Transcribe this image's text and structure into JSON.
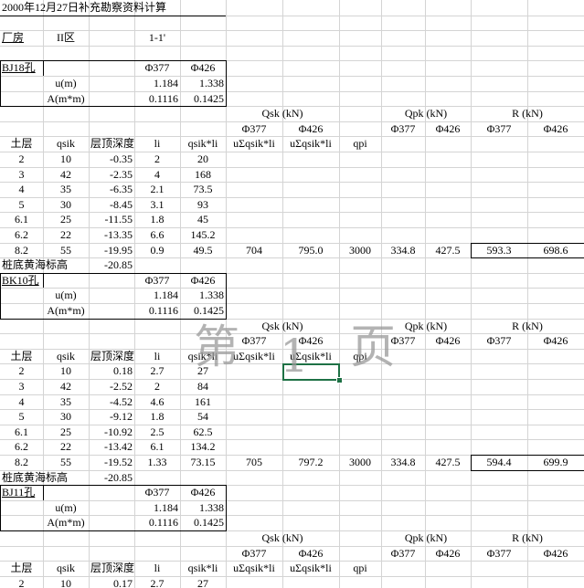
{
  "title": "2000年12月27日补充勘察资料计算",
  "header": {
    "factory": "厂房",
    "zone": "II区",
    "section": "1-1'"
  },
  "groups": [
    {
      "hole": "BJ18孔",
      "diam": [
        "Φ377",
        "Φ426"
      ],
      "u_label": "u(m)",
      "u": [
        "1.184",
        "1.338"
      ],
      "a_label": "A(m*m)",
      "a": [
        "0.1116",
        "0.1425"
      ],
      "qsk_label": "Qsk (kN)",
      "qpk_label": "Qpk (kN)",
      "r_label": "R (kN)",
      "sub_diam": [
        "Φ377",
        "Φ426",
        "Φ377",
        "Φ426",
        "Φ377",
        "Φ426"
      ],
      "headers": [
        "土层",
        "qsik",
        "层顶深度",
        "li",
        "qsik*li",
        "uΣqsik*li",
        "uΣqsik*li",
        "qpi"
      ],
      "rows": [
        [
          "2",
          "10",
          "-0.35",
          "2",
          "20"
        ],
        [
          "3",
          "42",
          "-2.35",
          "4",
          "168"
        ],
        [
          "4",
          "35",
          "-6.35",
          "2.1",
          "73.5"
        ],
        [
          "5",
          "30",
          "-8.45",
          "3.1",
          "93"
        ],
        [
          "6.1",
          "25",
          "-11.55",
          "1.8",
          "45"
        ],
        [
          "6.2",
          "22",
          "-13.35",
          "6.6",
          "145.2"
        ],
        [
          "8.2",
          "55",
          "-19.95",
          "0.9",
          "49.5",
          "704",
          "795.0",
          "3000",
          "334.8",
          "427.5",
          "593.3",
          "698.6"
        ]
      ],
      "bottom_label": "桩底黄海标高",
      "bottom_value": "-20.85"
    },
    {
      "hole": "BK10孔",
      "diam": [
        "Φ377",
        "Φ426"
      ],
      "u_label": "u(m)",
      "u": [
        "1.184",
        "1.338"
      ],
      "a_label": "A(m*m)",
      "a": [
        "0.1116",
        "0.1425"
      ],
      "qsk_label": "Qsk (kN)",
      "qpk_label": "Qpk (kN)",
      "r_label": "R (kN)",
      "sub_diam": [
        "Φ377",
        "Φ426",
        "Φ377",
        "Φ426",
        "Φ377",
        "Φ426"
      ],
      "headers": [
        "土层",
        "qsik",
        "层顶深度",
        "li",
        "qsik*li",
        "uΣqsik*li",
        "uΣqsik*li",
        "qpi"
      ],
      "rows": [
        [
          "2",
          "10",
          "0.18",
          "2.7",
          "27"
        ],
        [
          "3",
          "42",
          "-2.52",
          "2",
          "84"
        ],
        [
          "4",
          "35",
          "-4.52",
          "4.6",
          "161"
        ],
        [
          "5",
          "30",
          "-9.12",
          "1.8",
          "54"
        ],
        [
          "6.1",
          "25",
          "-10.92",
          "2.5",
          "62.5"
        ],
        [
          "6.2",
          "22",
          "-13.42",
          "6.1",
          "134.2"
        ],
        [
          "8.2",
          "55",
          "-19.52",
          "1.33",
          "73.15",
          "705",
          "797.2",
          "3000",
          "334.8",
          "427.5",
          "594.4",
          "699.9"
        ]
      ],
      "bottom_label": "桩底黄海标高",
      "bottom_value": "-20.85"
    },
    {
      "hole": "BJ11孔",
      "diam": [
        "Φ377",
        "Φ426"
      ],
      "u_label": "u(m)",
      "u": [
        "1.184",
        "1.338"
      ],
      "a_label": "A(m*m)",
      "a": [
        "0.1116",
        "0.1425"
      ],
      "qsk_label": "Qsk (kN)",
      "qpk_label": "Qpk (kN)",
      "r_label": "R (kN)",
      "sub_diam": [
        "Φ377",
        "Φ426",
        "Φ377",
        "Φ426",
        "Φ377",
        "Φ426"
      ],
      "headers": [
        "土层",
        "qsik",
        "层顶深度",
        "li",
        "qsik*li",
        "uΣqsik*li",
        "uΣqsik*li",
        "qpi"
      ],
      "rows": [
        [
          "2",
          "10",
          "0.17",
          "2.7",
          "27"
        ]
      ]
    }
  ],
  "watermark": [
    "第",
    "1",
    "页"
  ]
}
